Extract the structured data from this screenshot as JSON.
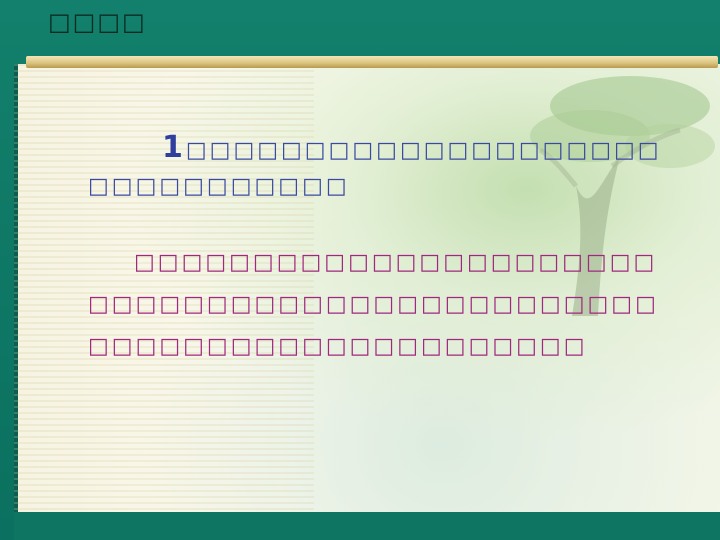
{
  "header": {
    "title": "□□□□"
  },
  "question": {
    "number": "1",
    "line1": "□□□□□□□□□□□□□□□□□□□□",
    "line2": "□□□□□□□□□□□"
  },
  "answer": {
    "line1": "□□□□□□□□□□□□□□□□□□□□□□",
    "line2": "□□□□□□□□□□□□□□□□□□□□□□□□",
    "line3": "□□□□□□□□□□□□□□□□□□□□□"
  },
  "colors": {
    "frame": "#0d7a68",
    "question_text": "#3a4aa0",
    "answer_text": "#a0287e"
  }
}
